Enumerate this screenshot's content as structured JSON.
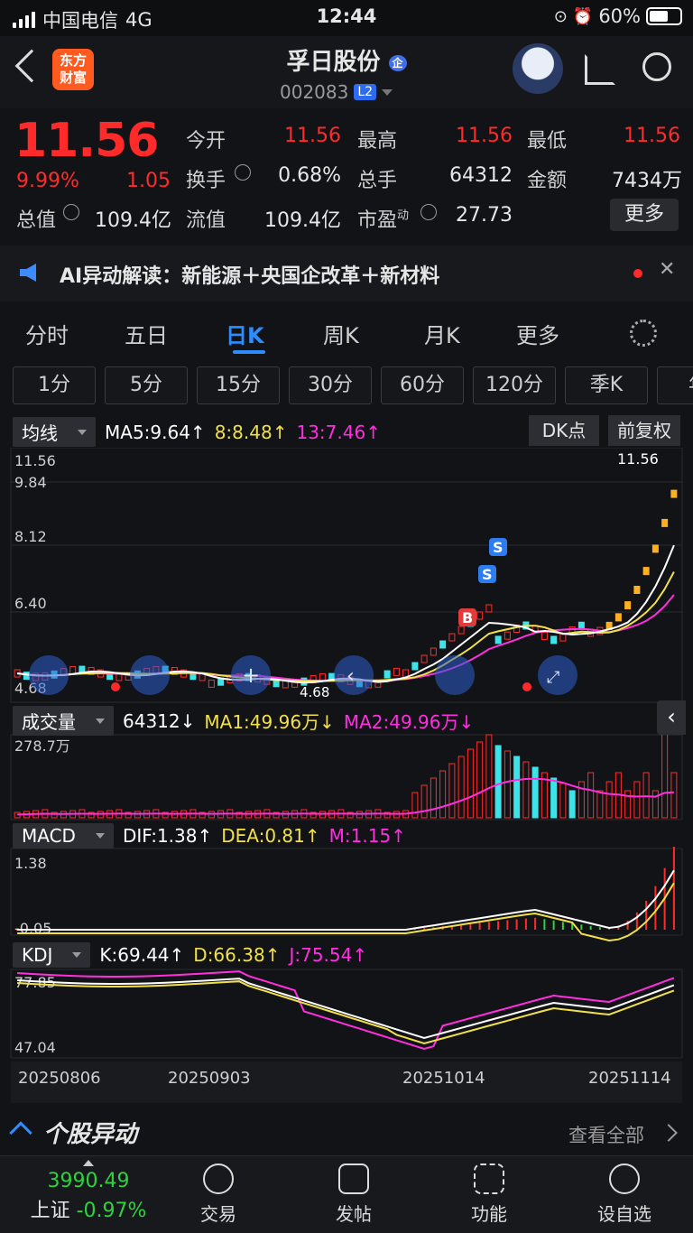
{
  "status_bar": {
    "carrier": "中国电信",
    "network": "4G",
    "time": "12:44",
    "battery": "60%"
  },
  "header": {
    "logo_line1": "东方",
    "logo_line2": "财富",
    "stock_name": "孚日股份",
    "name_badge": "企",
    "stock_code": "002083",
    "level_badge": "L2"
  },
  "quote": {
    "price": "11.56",
    "change_pct": "9.99%",
    "change_amt": "1.05",
    "open_label": "今开",
    "open": "11.56",
    "high_label": "最高",
    "high": "11.56",
    "low_label": "最低",
    "low": "11.56",
    "turnover_label": "换手",
    "turnover": "0.68%",
    "volume_label": "总手",
    "volume": "64312",
    "amount_label": "金额",
    "amount": "7434万",
    "mktcap_label": "总值",
    "mktcap": "109.4亿",
    "float_label": "流值",
    "float": "109.4亿",
    "pe_label": "市盈",
    "pe_sup": "动",
    "pe": "27.73",
    "more_button": "更多"
  },
  "ai_banner": {
    "text": "AI异动解读：新能源＋央国企改革＋新材料"
  },
  "tabs": [
    {
      "label": "分时"
    },
    {
      "label": "五日"
    },
    {
      "label": "日K"
    },
    {
      "label": "周K"
    },
    {
      "label": "月K"
    },
    {
      "label": "更多"
    }
  ],
  "periods": [
    "1分",
    "5分",
    "15分",
    "30分",
    "60分",
    "120分",
    "季K",
    "年"
  ],
  "kline_panel": {
    "selector": "均线",
    "ma5": "MA5:9.64↑",
    "ma8": "8:8.48↑",
    "ma13": "13:7.46↑",
    "dk_button": "DK点",
    "fq_button": "前复权",
    "y_labels": [
      "11.56",
      "9.84",
      "8.12",
      "6.40",
      "4.68"
    ],
    "last_price_tag": "11.56",
    "min_tag": "4.68",
    "markers": [
      "B",
      "S",
      "S"
    ]
  },
  "volume_panel": {
    "selector": "成交量",
    "vol": "64312↓",
    "ma1": "MA1:49.96万↓",
    "ma2": "MA2:49.96万↓",
    "y_label": "278.7万"
  },
  "macd_panel": {
    "selector": "MACD",
    "dif": "DIF:1.38↑",
    "dea": "DEA:0.81↑",
    "m": "M:1.15↑",
    "y_top": "1.38",
    "y_bottom": "-0.05"
  },
  "kdj_panel": {
    "selector": "KDJ",
    "k": "K:69.44↑",
    "d": "D:66.38↑",
    "j": "J:75.54↑",
    "y_top": "77.85",
    "y_bottom": "47.04"
  },
  "x_dates": [
    "20250806",
    "20250903",
    "20251014",
    "20251114"
  ],
  "stock_move": {
    "title": "个股异动",
    "view_all": "查看全部"
  },
  "bottom_bar": {
    "index_value": "3990.49",
    "index_name": "上证",
    "index_change": "-0.97%",
    "items": [
      "交易",
      "发帖",
      "功能",
      "设自选"
    ]
  },
  "colors": {
    "up": "#ff2b2b",
    "down": "#2fd13f",
    "ma5": "#ffffff",
    "ma8": "#f1e04a",
    "ma13": "#ff2fe0",
    "cyan": "#3de3e8",
    "accent": "#2d7cf0"
  }
}
